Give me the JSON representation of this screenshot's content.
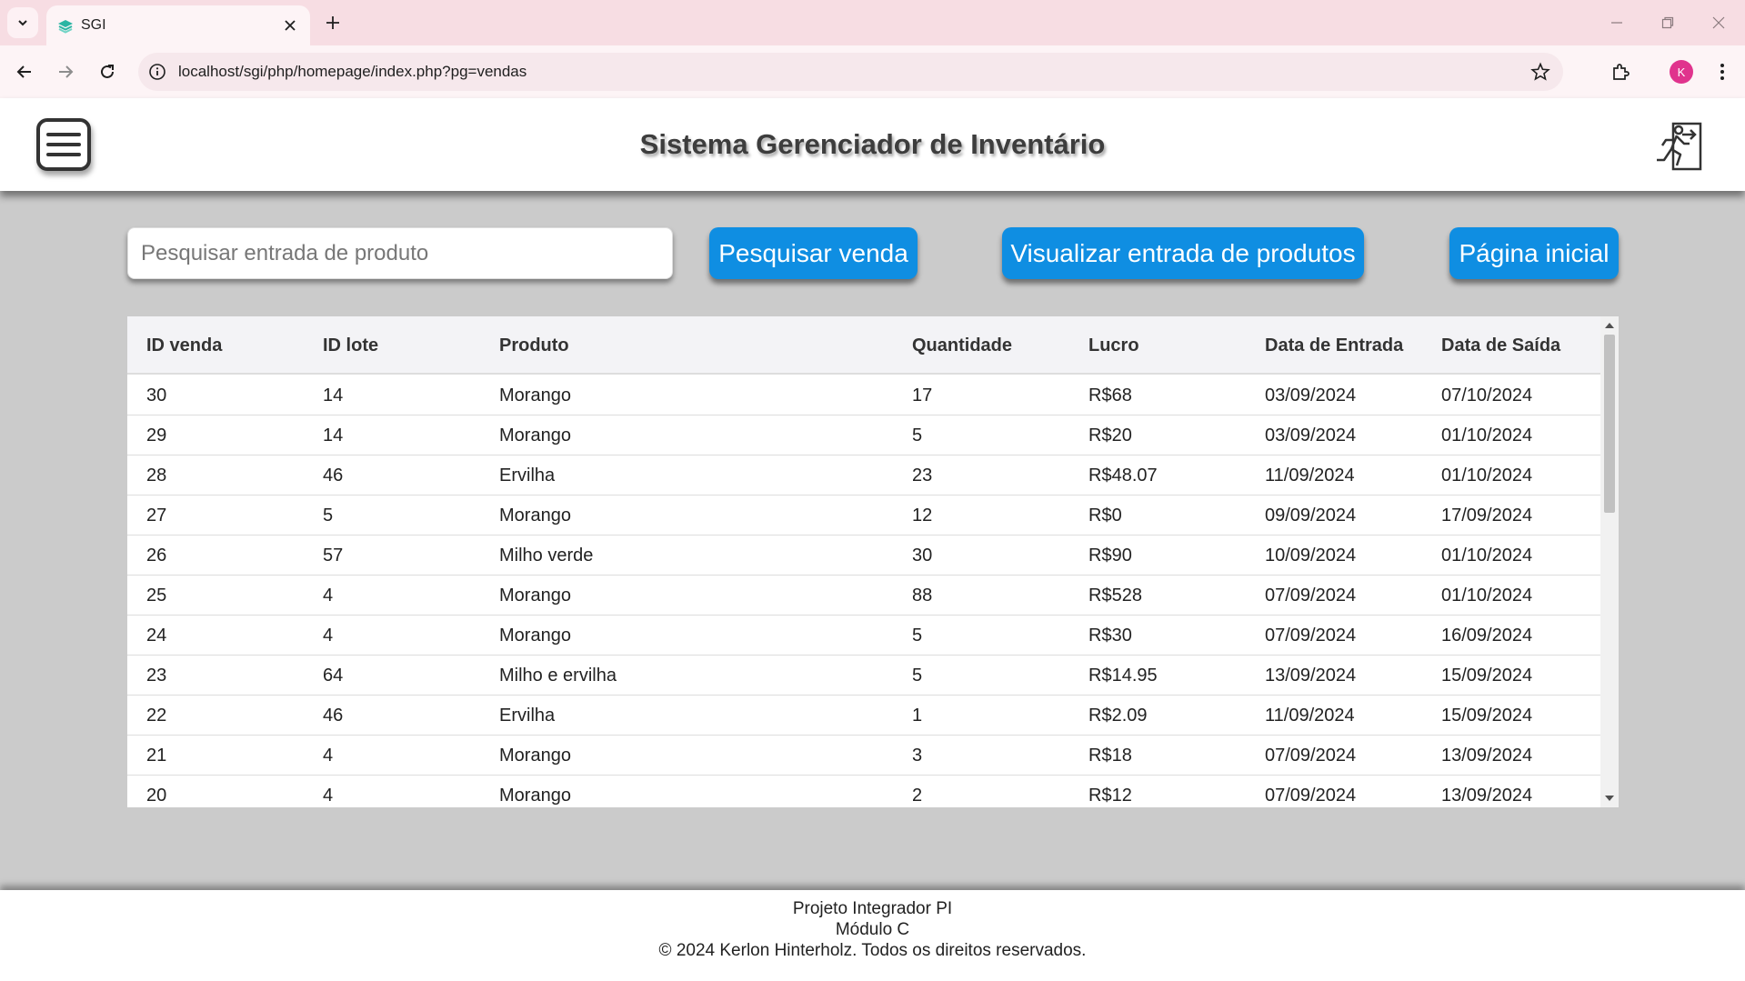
{
  "browser": {
    "tab_title": "SGI",
    "url": "localhost/sgi/php/homepage/index.php?pg=vendas",
    "profile_initial": "K"
  },
  "header": {
    "title": "Sistema Gerenciador de Inventário"
  },
  "controls": {
    "search_placeholder": "Pesquisar entrada de produto",
    "search_button": "Pesquisar venda",
    "view_entries_button": "Visualizar entrada de produtos",
    "home_button": "Página inicial"
  },
  "table": {
    "columns": [
      "ID venda",
      "ID lote",
      "Produto",
      "Quantidade",
      "Lucro",
      "Data de Entrada",
      "Data de Saída"
    ],
    "rows": [
      [
        "30",
        "14",
        "Morango",
        "17",
        "R$68",
        "03/09/2024",
        "07/10/2024"
      ],
      [
        "29",
        "14",
        "Morango",
        "5",
        "R$20",
        "03/09/2024",
        "01/10/2024"
      ],
      [
        "28",
        "46",
        "Ervilha",
        "23",
        "R$48.07",
        "11/09/2024",
        "01/10/2024"
      ],
      [
        "27",
        "5",
        "Morango",
        "12",
        "R$0",
        "09/09/2024",
        "17/09/2024"
      ],
      [
        "26",
        "57",
        "Milho verde",
        "30",
        "R$90",
        "10/09/2024",
        "01/10/2024"
      ],
      [
        "25",
        "4",
        "Morango",
        "88",
        "R$528",
        "07/09/2024",
        "01/10/2024"
      ],
      [
        "24",
        "4",
        "Morango",
        "5",
        "R$30",
        "07/09/2024",
        "16/09/2024"
      ],
      [
        "23",
        "64",
        "Milho e ervilha",
        "5",
        "R$14.95",
        "13/09/2024",
        "15/09/2024"
      ],
      [
        "22",
        "46",
        "Ervilha",
        "1",
        "R$2.09",
        "11/09/2024",
        "15/09/2024"
      ],
      [
        "21",
        "4",
        "Morango",
        "3",
        "R$18",
        "07/09/2024",
        "13/09/2024"
      ],
      [
        "20",
        "4",
        "Morango",
        "2",
        "R$12",
        "07/09/2024",
        "13/09/2024"
      ]
    ]
  },
  "footer": {
    "line1": "Projeto Integrador PI",
    "line2": "Módulo C",
    "line3": "© 2024 Kerlon Hinterholz. Todos os direitos reservados."
  },
  "colors": {
    "accent_blue": "#0f8ee2",
    "page_background": "#cbcbcb",
    "browser_tabstrip": "#f7dde3",
    "profile_avatar": "#e0338d"
  }
}
